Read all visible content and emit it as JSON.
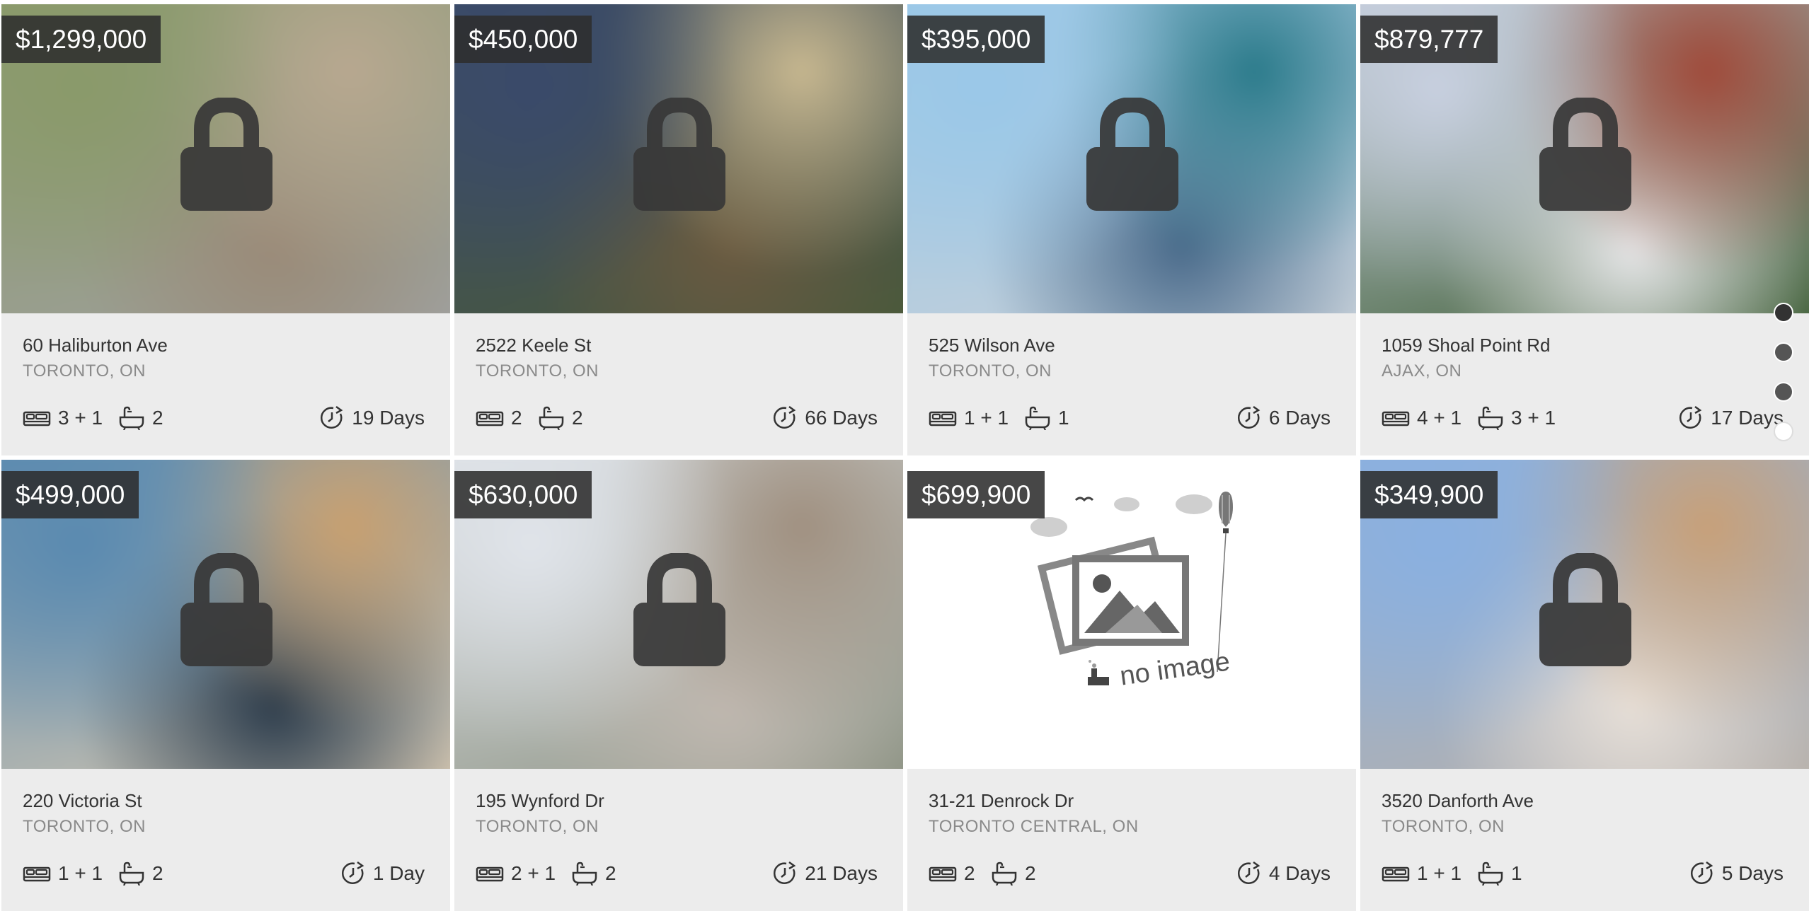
{
  "listings": [
    {
      "price": "$1,299,000",
      "street": "60 Haliburton Ave",
      "city": "TORONTO, ON",
      "beds": "3 + 1",
      "baths": "2",
      "days": "19 Days",
      "image": "photo",
      "colors": [
        "#8a9a6a",
        "#b8a890",
        "#9a8a78",
        "#a0a0a0"
      ]
    },
    {
      "price": "$450,000",
      "street": "2522 Keele St",
      "city": "TORONTO, ON",
      "beds": "2",
      "baths": "2",
      "days": "66 Days",
      "image": "photo",
      "colors": [
        "#3a4a6a",
        "#c8b890",
        "#6a5a40",
        "#4a5a38"
      ]
    },
    {
      "price": "$395,000",
      "street": "525 Wilson Ave",
      "city": "TORONTO, ON",
      "beds": "1 + 1",
      "baths": "1",
      "days": "6 Days",
      "image": "photo",
      "colors": [
        "#9ac8e8",
        "#2a7a8a",
        "#4a6a8a",
        "#c8d0d8"
      ]
    },
    {
      "price": "$879,777",
      "street": "1059 Shoal Point Rd",
      "city": "AJAX, ON",
      "beds": "4 + 1",
      "baths": "3 + 1",
      "days": "17 Days",
      "image": "photo",
      "colors": [
        "#c8d0e0",
        "#a04a3a",
        "#e8e8ea",
        "#3a5a30"
      ]
    },
    {
      "price": "$499,000",
      "street": "220 Victoria St",
      "city": "TORONTO, ON",
      "beds": "1 + 1",
      "baths": "2",
      "days": "1 Day",
      "image": "photo",
      "colors": [
        "#5a8ab0",
        "#c8a070",
        "#2a3a4a",
        "#d8c8b0"
      ]
    },
    {
      "price": "$630,000",
      "street": "195 Wynford Dr",
      "city": "TORONTO, ON",
      "beds": "2 + 1",
      "baths": "2",
      "days": "21 Days",
      "image": "photo",
      "colors": [
        "#e0e4ea",
        "#a09080",
        "#c0b8b0",
        "#8a9080"
      ]
    },
    {
      "price": "$699,900",
      "street": "31-21 Denrock Dr",
      "city": "TORONTO CENTRAL, ON",
      "beds": "2",
      "baths": "2",
      "days": "4 Days",
      "image": "none",
      "noimage_text": "no image"
    },
    {
      "price": "$349,900",
      "street": "3520 Danforth Ave",
      "city": "TORONTO, ON",
      "beds": "1 + 1",
      "baths": "1",
      "days": "5 Days",
      "image": "photo",
      "colors": [
        "#8ab0e0",
        "#c8a078",
        "#e8e0d8",
        "#b8b0a8"
      ]
    }
  ],
  "pager": {
    "count": 4,
    "active": 4
  },
  "icons": {
    "beds": "bed-icon",
    "baths": "bathtub-icon",
    "days": "clock-icon",
    "lock": "lock-icon"
  }
}
